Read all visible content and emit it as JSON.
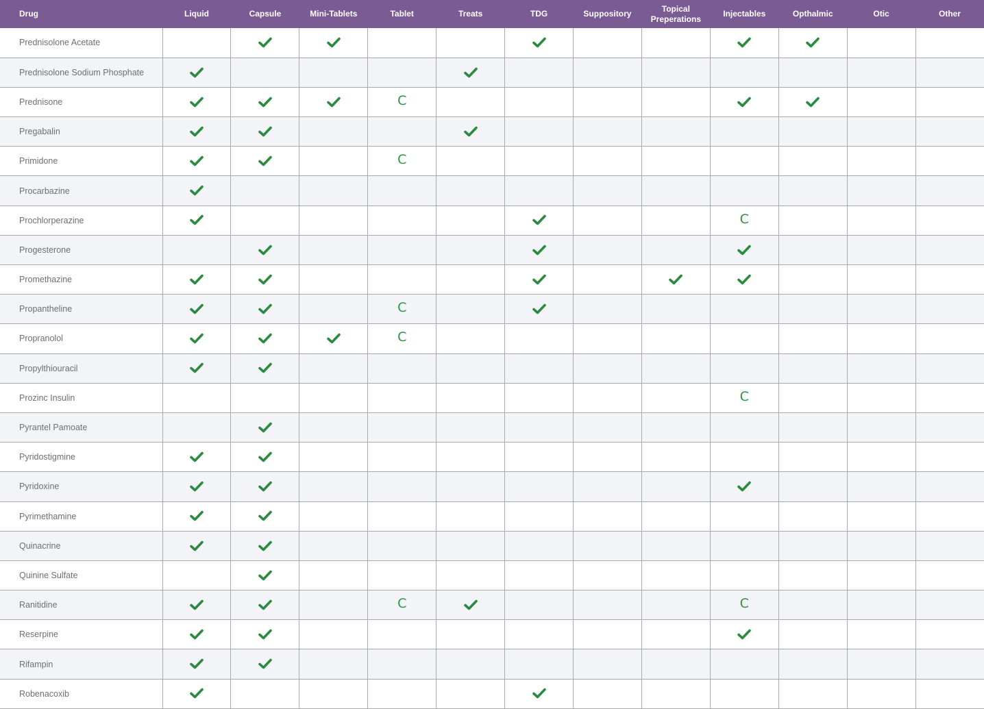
{
  "colors": {
    "header_bg": "#7a5b93",
    "header_text": "#ffffff",
    "check": "#2a8a3e",
    "compound_letter": "#2d9443",
    "row_alt": "#f3f4f8",
    "grid_line": "#a9a9ad",
    "drug_text": "#6f6f73"
  },
  "icons": {
    "check": "checkmark-icon"
  },
  "columns": [
    "Drug",
    "Liquid",
    "Capsule",
    "Mini-Tablets",
    "Tablet",
    "Treats",
    "TDG",
    "Suppository",
    "Topical Preperations",
    "Injectables",
    "Opthalmic",
    "Otic",
    "Other"
  ],
  "rows": [
    {
      "drug": "Prednisolone Acetate",
      "cells": [
        "",
        "check",
        "check",
        "",
        "",
        "check",
        "",
        "",
        "check",
        "check",
        "",
        ""
      ]
    },
    {
      "drug": "Prednisolone Sodium Phosphate",
      "cells": [
        "check",
        "",
        "",
        "",
        "check",
        "",
        "",
        "",
        "",
        "",
        "",
        ""
      ]
    },
    {
      "drug": "Prednisone",
      "cells": [
        "check",
        "check",
        "check",
        "C",
        "",
        "",
        "",
        "",
        "check",
        "check",
        "",
        ""
      ]
    },
    {
      "drug": "Pregabalin",
      "cells": [
        "check",
        "check",
        "",
        "",
        "check",
        "",
        "",
        "",
        "",
        "",
        "",
        ""
      ]
    },
    {
      "drug": "Primidone",
      "cells": [
        "check",
        "check",
        "",
        "C",
        "",
        "",
        "",
        "",
        "",
        "",
        "",
        ""
      ]
    },
    {
      "drug": "Procarbazine",
      "cells": [
        "check",
        "",
        "",
        "",
        "",
        "",
        "",
        "",
        "",
        "",
        "",
        ""
      ]
    },
    {
      "drug": "Prochlorperazine",
      "cells": [
        "check",
        "",
        "",
        "",
        "",
        "check",
        "",
        "",
        "C",
        "",
        "",
        ""
      ]
    },
    {
      "drug": "Progesterone",
      "cells": [
        "",
        "check",
        "",
        "",
        "",
        "check",
        "",
        "",
        "check",
        "",
        "",
        ""
      ]
    },
    {
      "drug": "Promethazine",
      "cells": [
        "check",
        "check",
        "",
        "",
        "",
        "check",
        "",
        "check",
        "check",
        "",
        "",
        ""
      ]
    },
    {
      "drug": "Propantheline",
      "cells": [
        "check",
        "check",
        "",
        "C",
        "",
        "check",
        "",
        "",
        "",
        "",
        "",
        ""
      ]
    },
    {
      "drug": "Propranolol",
      "cells": [
        "check",
        "check",
        "check",
        "C",
        "",
        "",
        "",
        "",
        "",
        "",
        "",
        ""
      ]
    },
    {
      "drug": "Propylthiouracil",
      "cells": [
        "check",
        "check",
        "",
        "",
        "",
        "",
        "",
        "",
        "",
        "",
        "",
        ""
      ]
    },
    {
      "drug": "Prozinc Insulin",
      "cells": [
        "",
        "",
        "",
        "",
        "",
        "",
        "",
        "",
        "C",
        "",
        "",
        ""
      ]
    },
    {
      "drug": "Pyrantel Pamoate",
      "cells": [
        "",
        "check",
        "",
        "",
        "",
        "",
        "",
        "",
        "",
        "",
        "",
        ""
      ]
    },
    {
      "drug": "Pyridostigmine",
      "cells": [
        "check",
        "check",
        "",
        "",
        "",
        "",
        "",
        "",
        "",
        "",
        "",
        ""
      ]
    },
    {
      "drug": "Pyridoxine",
      "cells": [
        "check",
        "check",
        "",
        "",
        "",
        "",
        "",
        "",
        "check",
        "",
        "",
        ""
      ]
    },
    {
      "drug": "Pyrimethamine",
      "cells": [
        "check",
        "check",
        "",
        "",
        "",
        "",
        "",
        "",
        "",
        "",
        "",
        ""
      ]
    },
    {
      "drug": "Quinacrine",
      "cells": [
        "check",
        "check",
        "",
        "",
        "",
        "",
        "",
        "",
        "",
        "",
        "",
        ""
      ]
    },
    {
      "drug": "Quinine Sulfate",
      "cells": [
        "",
        "check",
        "",
        "",
        "",
        "",
        "",
        "",
        "",
        "",
        "",
        ""
      ]
    },
    {
      "drug": "Ranitidine",
      "cells": [
        "check",
        "check",
        "",
        "C",
        "check",
        "",
        "",
        "",
        "C",
        "",
        "",
        ""
      ]
    },
    {
      "drug": "Reserpine",
      "cells": [
        "check",
        "check",
        "",
        "",
        "",
        "",
        "",
        "",
        "check",
        "",
        "",
        ""
      ]
    },
    {
      "drug": "Rifampin",
      "cells": [
        "check",
        "check",
        "",
        "",
        "",
        "",
        "",
        "",
        "",
        "",
        "",
        ""
      ]
    },
    {
      "drug": "Robenacoxib",
      "cells": [
        "check",
        "",
        "",
        "",
        "",
        "check",
        "",
        "",
        "",
        "",
        "",
        ""
      ]
    }
  ]
}
